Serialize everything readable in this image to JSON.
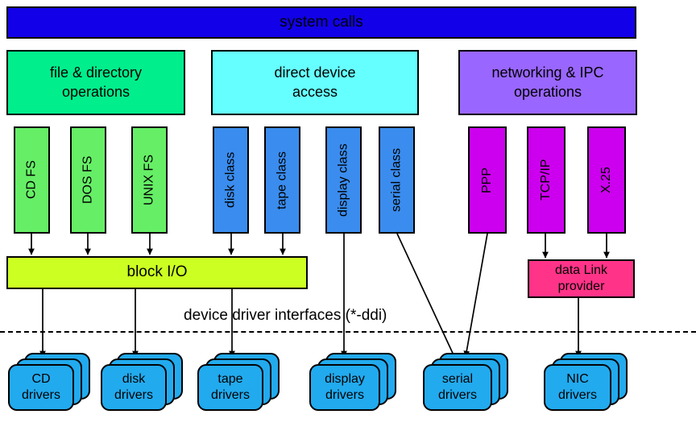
{
  "diagram": {
    "title": "system calls",
    "ddi_label": "device driver interfaces (*-ddi)",
    "colors": {
      "system_calls": "#1200E8",
      "file_dir_ops": "#00EE8C",
      "direct_device": "#66FFFF",
      "networking_ipc": "#9966FF",
      "fs_module": "#66EE66",
      "device_class": "#3A8CEE",
      "net_protocol": "#CC00EE",
      "block_io": "#CCFF22",
      "data_link_provider": "#FF3388",
      "driver_card": "#22AAEE",
      "stroke": "#000000"
    }
  },
  "system_calls": {
    "label": "system calls"
  },
  "subsystems": [
    {
      "id": "file-directory-operations",
      "label": "file & directory\noperations"
    },
    {
      "id": "direct-device-access",
      "label": "direct device\naccess"
    },
    {
      "id": "networking-ipc-operations",
      "label": "networking & IPC\noperations"
    }
  ],
  "modules": [
    {
      "id": "cd-fs",
      "label": "CD FS",
      "group": "filesystem"
    },
    {
      "id": "dos-fs",
      "label": "DOS FS",
      "group": "filesystem"
    },
    {
      "id": "unix-fs",
      "label": "UNIX FS",
      "group": "filesystem"
    },
    {
      "id": "disk-class",
      "label": "disk class",
      "group": "device-class"
    },
    {
      "id": "tape-class",
      "label": "tape class",
      "group": "device-class"
    },
    {
      "id": "display-class",
      "label": "display class",
      "group": "device-class"
    },
    {
      "id": "serial-class",
      "label": "serial class",
      "group": "device-class"
    },
    {
      "id": "ppp",
      "label": "PPP",
      "group": "network"
    },
    {
      "id": "tcp-ip",
      "label": "TCP/IP",
      "group": "network"
    },
    {
      "id": "x25",
      "label": "X.25",
      "group": "network"
    }
  ],
  "middleware": [
    {
      "id": "block-io",
      "label": "block I/O"
    },
    {
      "id": "data-link-provider",
      "label": "data Link\nprovider"
    }
  ],
  "drivers": [
    {
      "id": "cd-drivers",
      "label": "CD\ndrivers"
    },
    {
      "id": "disk-drivers",
      "label": "disk\ndrivers"
    },
    {
      "id": "tape-drivers",
      "label": "tape\ndrivers"
    },
    {
      "id": "display-drivers",
      "label": "display\ndrivers"
    },
    {
      "id": "serial-drivers",
      "label": "serial\ndrivers"
    },
    {
      "id": "nic-drivers",
      "label": "NIC\ndrivers"
    }
  ],
  "connections": [
    {
      "from": "cd-fs",
      "to": "block-io"
    },
    {
      "from": "dos-fs",
      "to": "block-io"
    },
    {
      "from": "unix-fs",
      "to": "block-io"
    },
    {
      "from": "disk-class",
      "to": "block-io"
    },
    {
      "from": "tape-class",
      "to": "block-io"
    },
    {
      "from": "block-io",
      "to": "cd-drivers"
    },
    {
      "from": "block-io",
      "to": "disk-drivers"
    },
    {
      "from": "block-io",
      "to": "tape-drivers"
    },
    {
      "from": "display-class",
      "to": "display-drivers"
    },
    {
      "from": "serial-class",
      "to": "serial-drivers"
    },
    {
      "from": "ppp",
      "to": "serial-drivers"
    },
    {
      "from": "tcp-ip",
      "to": "data-link-provider"
    },
    {
      "from": "x25",
      "to": "data-link-provider"
    },
    {
      "from": "data-link-provider",
      "to": "nic-drivers"
    }
  ]
}
